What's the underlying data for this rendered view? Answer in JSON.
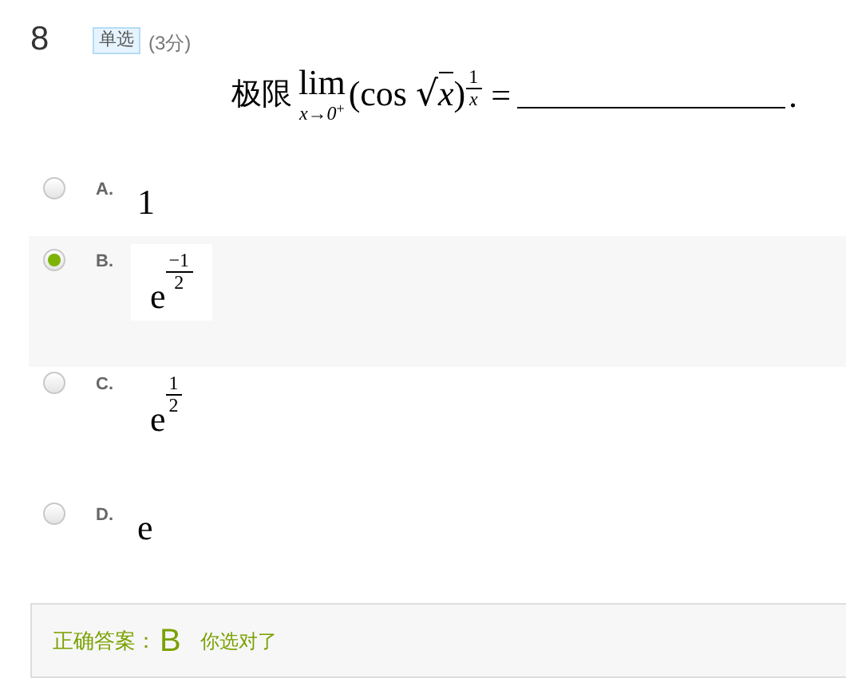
{
  "question": {
    "number": "8",
    "type_badge": "单选",
    "score": "(3分)",
    "formula": {
      "prefix": "极限",
      "operator": "lim",
      "subscript": "x→0",
      "subscript_sup": "+",
      "open": "(cos",
      "radical": "√",
      "radicand": "x",
      "close": ")",
      "exp_num": "1",
      "exp_den": "x",
      "equals": "=",
      "end": "."
    }
  },
  "options": [
    {
      "label": "A.",
      "kind": "plain",
      "value": "1",
      "selected": false
    },
    {
      "label": "B.",
      "kind": "power",
      "base": "e",
      "exp_num": "−1",
      "exp_den": "2",
      "selected": true
    },
    {
      "label": "C.",
      "kind": "power",
      "base": "e",
      "exp_num": "1",
      "exp_den": "2",
      "selected": false
    },
    {
      "label": "D.",
      "kind": "plain",
      "value": "e",
      "selected": false
    }
  ],
  "result": {
    "label": "正确答案：",
    "answer": "B",
    "verdict": "你选对了"
  }
}
